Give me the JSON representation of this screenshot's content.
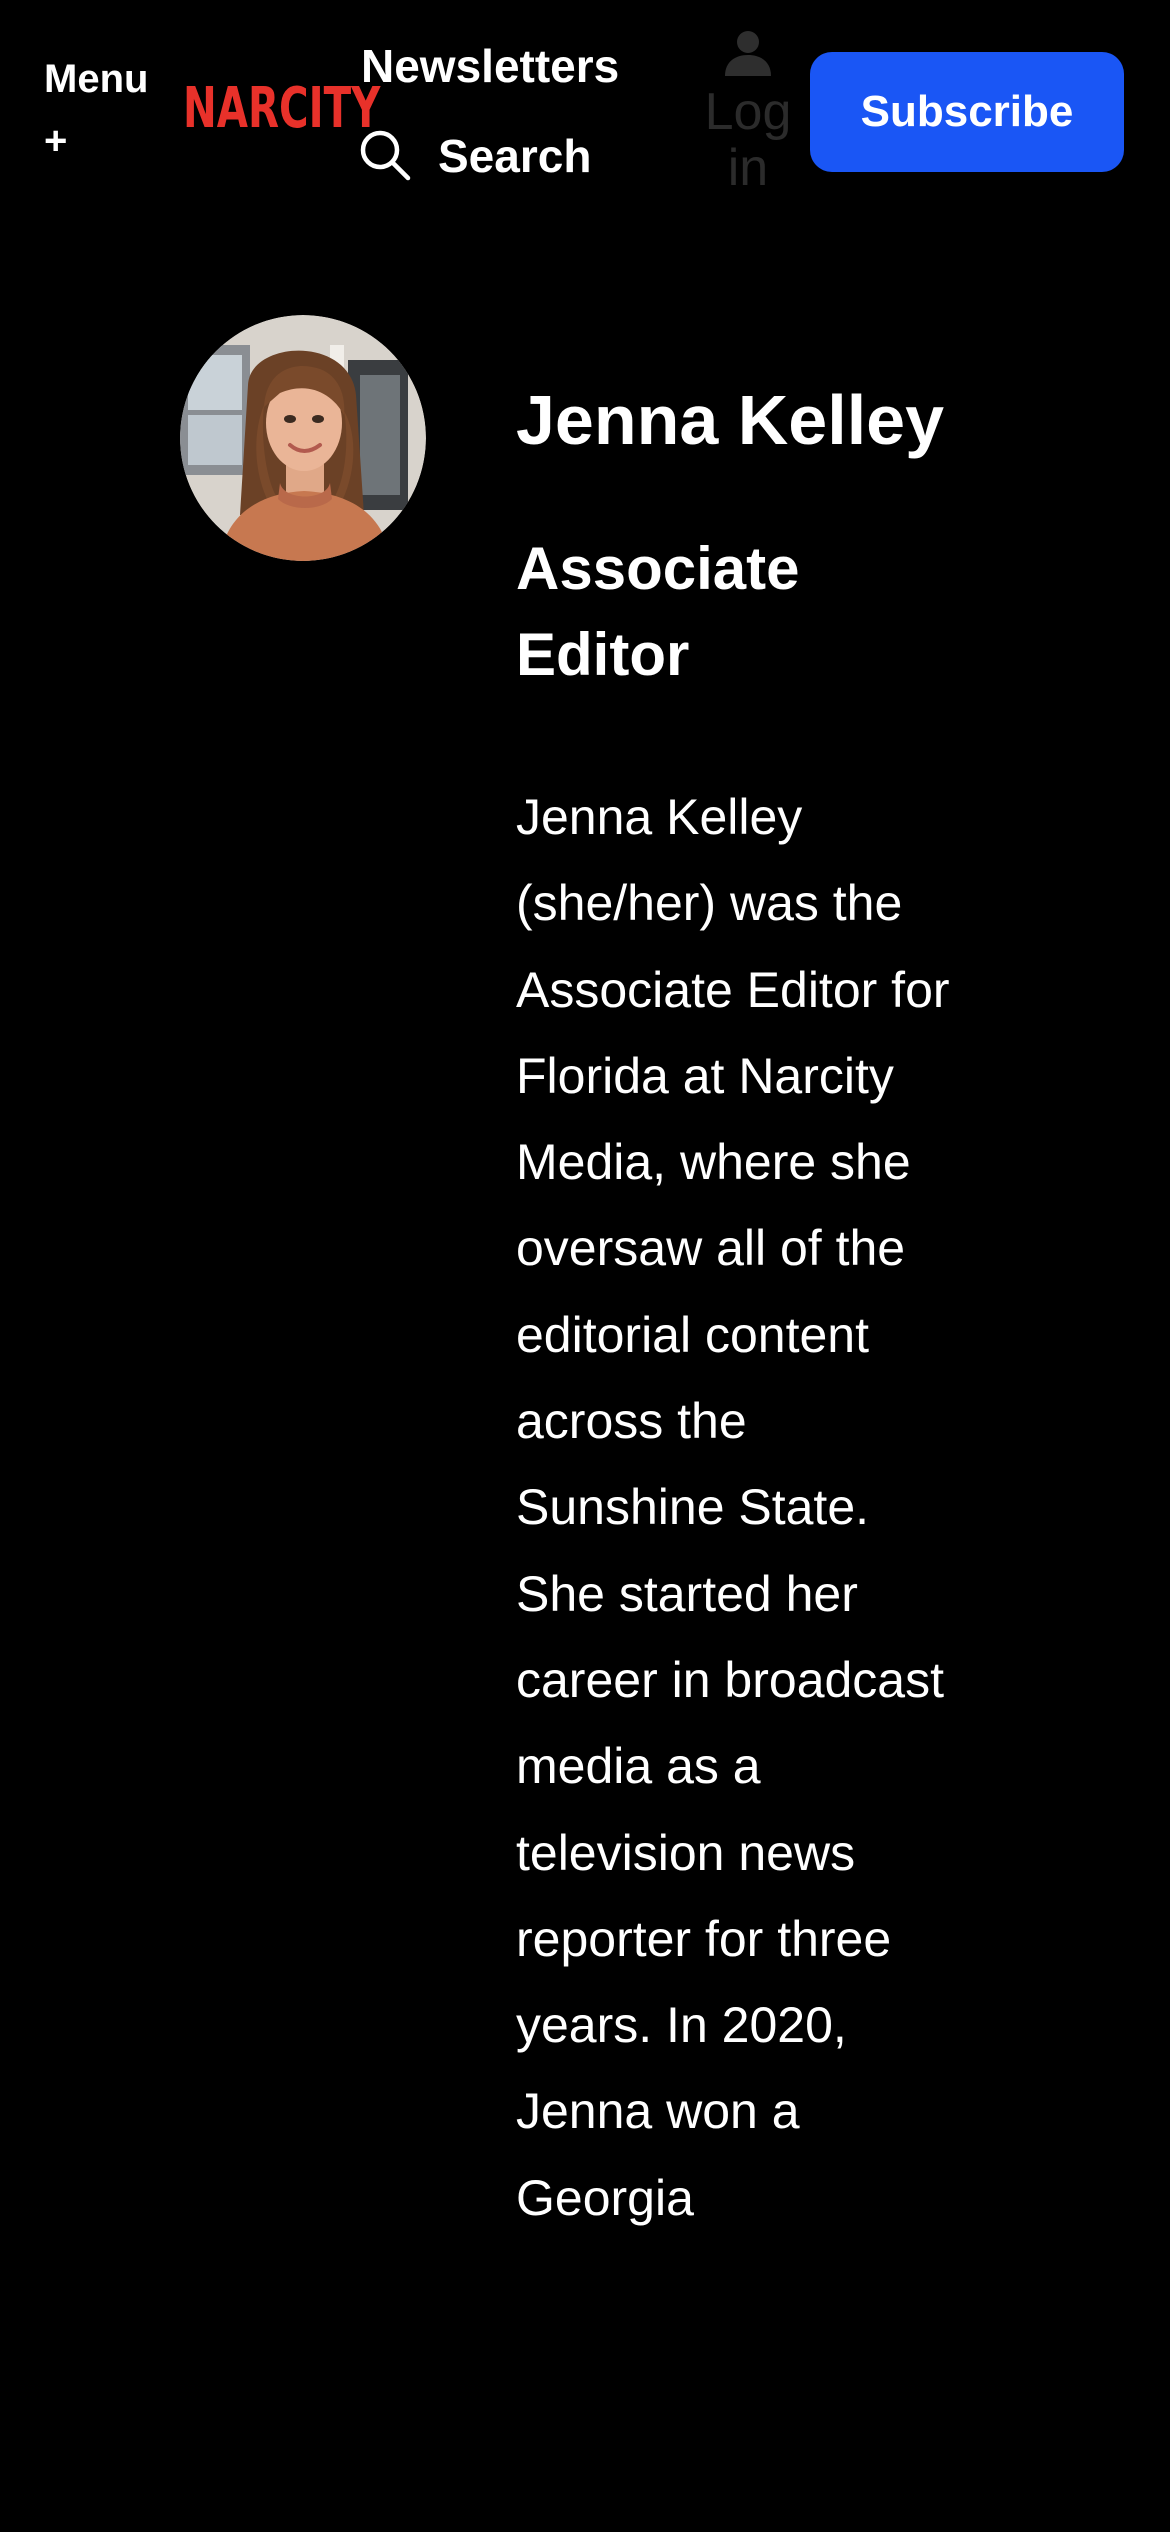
{
  "header": {
    "menu_label": "Menu",
    "menu_plus": "+",
    "logo_text": "NARCITY",
    "newsletters_label": "Newsletters",
    "search_label": "Search",
    "login_label": "Log in",
    "subscribe_label": "Subscribe",
    "colors": {
      "logo": "#e8312a",
      "subscribe_bg": "#1a56f5",
      "login_dim": "#2b2b2b"
    }
  },
  "author": {
    "name": "Jenna Kelley",
    "title": "Associate Editor",
    "bio": "Jenna Kelley (she/her) was the Associate Editor for Florida at Narcity Media, where she oversaw all of the editorial content across the Sunshine State. She started her career in broadcast media as a television news reporter for three years. In 2020, Jenna won a Georgia"
  },
  "icons": {
    "search": "search-icon",
    "user": "user-icon"
  }
}
